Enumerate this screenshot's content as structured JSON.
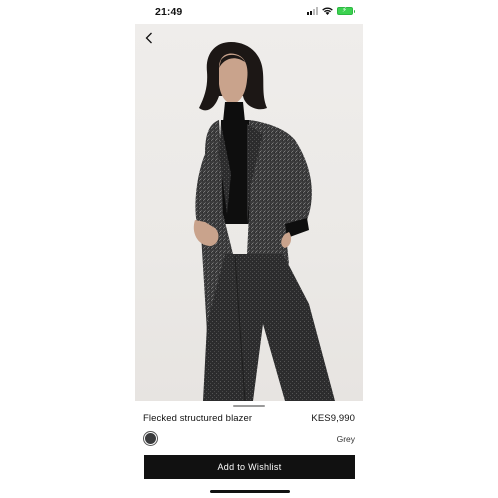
{
  "status_bar": {
    "time": "21:49",
    "icons": [
      "signal-icon",
      "wifi-icon",
      "battery-icon"
    ],
    "battery_color": "#3cd250"
  },
  "navigation": {
    "back_icon": "chevron-left-icon"
  },
  "product": {
    "name": "Flecked structured blazer",
    "price": "KES9,990",
    "selected_color_label": "Grey",
    "swatch_color": "#3a3b3d"
  },
  "actions": {
    "wishlist_label": "Add to Wishlist"
  },
  "colors": {
    "background": "#ffffff",
    "button": "#111111",
    "image_backdrop": "#ecebe8"
  }
}
